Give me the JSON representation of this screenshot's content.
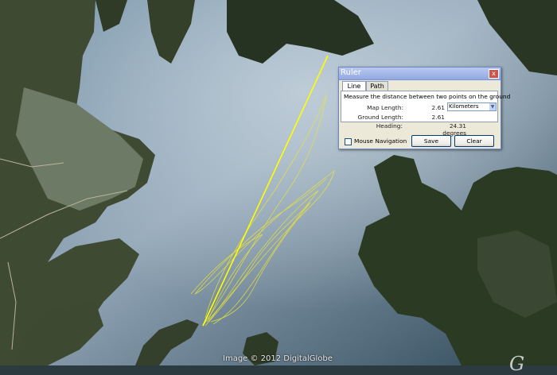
{
  "ruler": {
    "title": "Ruler",
    "close_label": "x",
    "tabs": [
      {
        "label": "Line",
        "active": true
      },
      {
        "label": "Path",
        "active": false
      }
    ],
    "description": "Measure the distance between two points on the ground",
    "map_length_label": "Map Length:",
    "map_length_value": "2.61",
    "unit_selected": "Kilometers",
    "ground_length_label": "Ground Length:",
    "ground_length_value": "2.61",
    "heading_label": "Heading:",
    "heading_value": "24.31 degrees",
    "mouse_navigation_label": "Mouse Navigation",
    "mouse_navigation_checked": false,
    "save_label": "Save",
    "clear_label": "Clear"
  },
  "map": {
    "credit": "Image © 2012 DigitalGlobe",
    "watermark": "G",
    "track_color": "#e8e33a",
    "ruler_line_color": "#ffff00"
  }
}
